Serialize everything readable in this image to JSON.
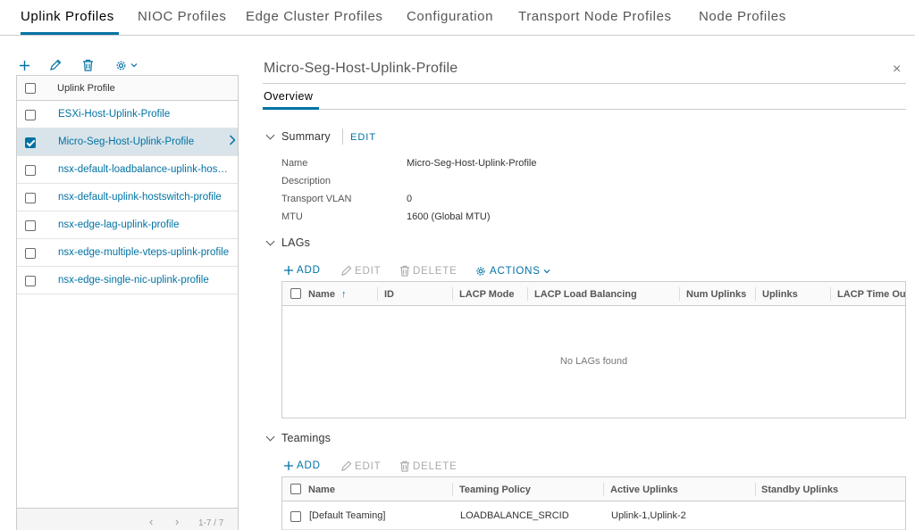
{
  "tabs": [
    {
      "label": "Uplink Profiles"
    },
    {
      "label": "NIOC Profiles"
    },
    {
      "label": "Edge Cluster Profiles"
    },
    {
      "label": "Configuration"
    },
    {
      "label": "Transport Node Profiles"
    },
    {
      "label": "Node Profiles"
    }
  ],
  "left_toolbar": {
    "add": "add-icon",
    "edit": "pencil-icon",
    "delete": "trash-icon",
    "settings": "gear-icon"
  },
  "profile_list": {
    "header": "Uplink Profile",
    "items": [
      {
        "label": "ESXi-Host-Uplink-Profile",
        "selected": false
      },
      {
        "label": "Micro-Seg-Host-Uplink-Profile",
        "selected": true
      },
      {
        "label": "nsx-default-loadbalance-uplink-hostswitch-profile",
        "selected": false
      },
      {
        "label": "nsx-default-uplink-hostswitch-profile",
        "selected": false
      },
      {
        "label": "nsx-edge-lag-uplink-profile",
        "selected": false
      },
      {
        "label": "nsx-edge-multiple-vteps-uplink-profile",
        "selected": false
      },
      {
        "label": "nsx-edge-single-nic-uplink-profile",
        "selected": false
      }
    ],
    "pager": {
      "prev": "‹",
      "next": "›",
      "range": "1-7 / 7"
    }
  },
  "detail": {
    "title": "Micro-Seg-Host-Uplink-Profile",
    "close": "×",
    "subtab": "Overview",
    "summary": {
      "title": "Summary",
      "edit": "EDIT",
      "fields": [
        {
          "key": "Name",
          "value": "Micro-Seg-Host-Uplink-Profile"
        },
        {
          "key": "Description",
          "value": ""
        },
        {
          "key": "Transport VLAN",
          "value": "0"
        },
        {
          "key": "MTU",
          "value": "1600 (Global MTU)"
        }
      ]
    },
    "lags": {
      "title": "LAGs",
      "actions": {
        "add": "ADD",
        "edit": "EDIT",
        "delete": "DELETE",
        "more": "ACTIONS"
      },
      "columns": [
        "Name",
        "ID",
        "LACP Mode",
        "LACP Load Balancing",
        "Num Uplinks",
        "Uplinks",
        "LACP Time Out"
      ],
      "sort_indicator": "↑",
      "empty": "No LAGs found"
    },
    "teamings": {
      "title": "Teamings",
      "actions": {
        "add": "ADD",
        "edit": "EDIT",
        "delete": "DELETE"
      },
      "columns": [
        "Name",
        "Teaming Policy",
        "Active Uplinks",
        "Standby Uplinks"
      ],
      "rows": [
        {
          "name": "[Default Teaming]",
          "policy": "LOADBALANCE_SRCID",
          "active": "Uplink-1,Uplink-2",
          "standby": ""
        }
      ]
    }
  },
  "colors": {
    "accent": "#0072a3",
    "selected_row": "#d9e4ea",
    "border": "#cccccc"
  }
}
